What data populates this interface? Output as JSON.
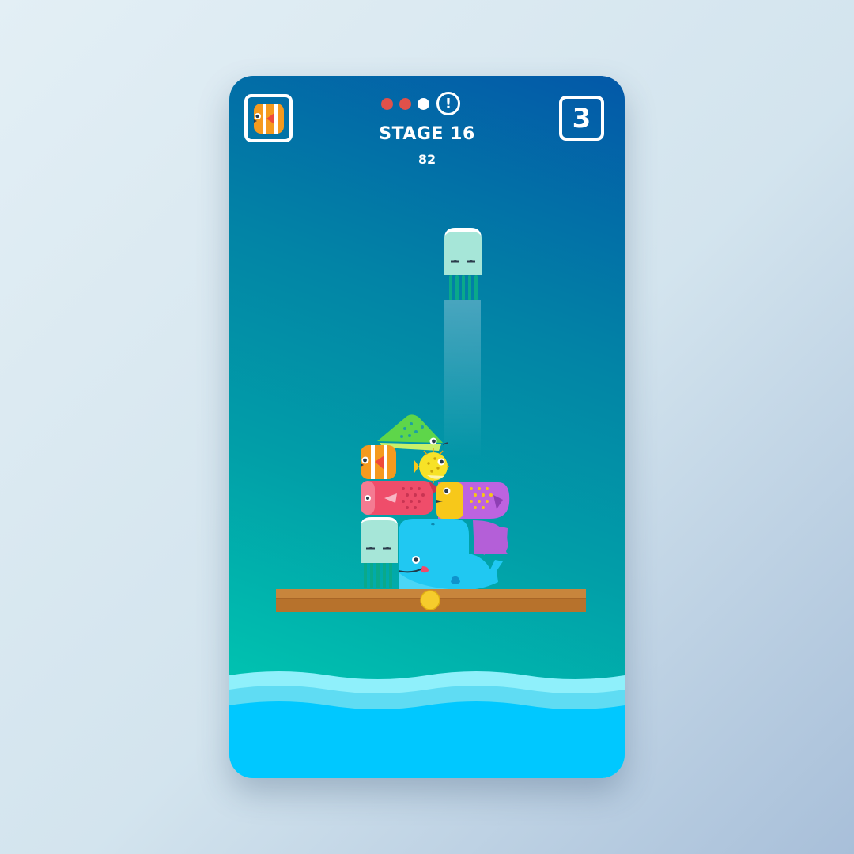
{
  "hud": {
    "selected_character_icon": "clownfish-icon",
    "progress": {
      "dots": [
        "#e0514a",
        "#e0514a",
        "#ffffff"
      ],
      "alert_icon": "!"
    },
    "stage_label": "STAGE 16",
    "score": "82",
    "lives": "3"
  },
  "scene": {
    "falling_piece": "jellyfish",
    "stacked_pieces": [
      "angelfish",
      "clownfish",
      "pufferfish",
      "red-koi",
      "purple-koi",
      "jellyfish",
      "whale"
    ],
    "platform_pivot_color": "#f6cc2c",
    "water_colors": [
      "#8ff0fb",
      "#5fdcf3",
      "#00c8ff"
    ]
  }
}
